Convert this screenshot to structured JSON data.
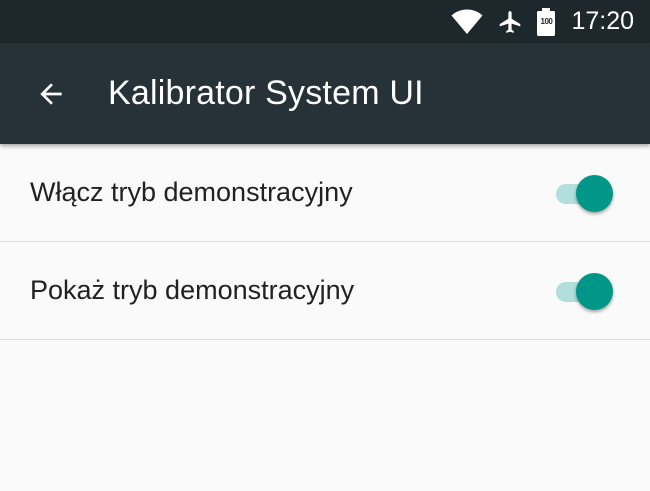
{
  "status_bar": {
    "battery_text": "100",
    "time": "17:20"
  },
  "toolbar": {
    "title": "Kalibrator System UI"
  },
  "settings": [
    {
      "label": "Włącz tryb demonstracyjny",
      "checked": true
    },
    {
      "label": "Pokaż tryb demonstracyjny",
      "checked": true
    }
  ],
  "colors": {
    "status_bar_bg": "#1e272b",
    "toolbar_bg": "#263238",
    "page_bg": "#fafafa",
    "switch_thumb": "#009688",
    "switch_track": "#b2dfdb"
  },
  "icons": {
    "status": [
      "wifi-icon",
      "airplane-icon",
      "battery-icon"
    ],
    "toolbar": "back-arrow-icon"
  }
}
